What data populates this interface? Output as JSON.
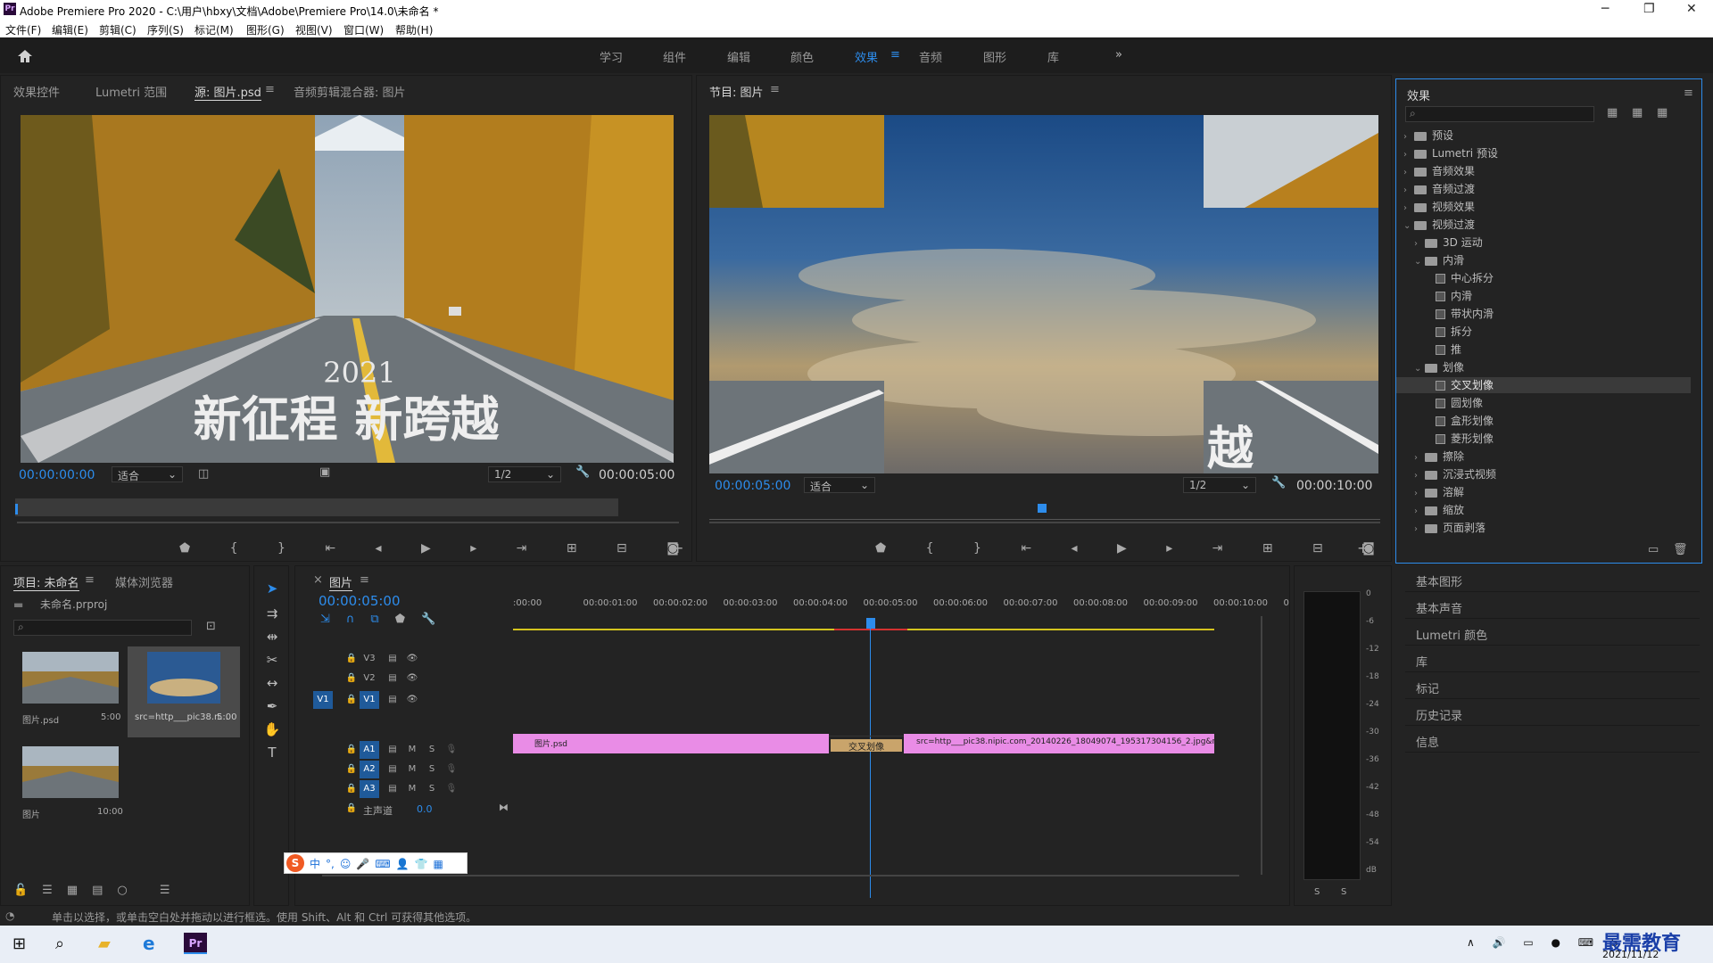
{
  "window": {
    "title": "Adobe Premiere Pro 2020 - C:\\用户\\hbxy\\文档\\Adobe\\Premiere Pro\\14.0\\未命名 *",
    "app_icon": "Pr"
  },
  "menu": [
    "文件(F)",
    "编辑(E)",
    "剪辑(C)",
    "序列(S)",
    "标记(M)",
    "图形(G)",
    "视图(V)",
    "窗口(W)",
    "帮助(H)"
  ],
  "workspaces": [
    "学习",
    "组件",
    "编辑",
    "颜色",
    "效果",
    "音频",
    "图形",
    "库"
  ],
  "workspace_active": "效果",
  "workspace_more": "»",
  "source": {
    "tabs": [
      "效果控件",
      "Lumetri 范围",
      "源: 图片.psd",
      "音频剪辑混合器: 图片"
    ],
    "active_tab": "源: 图片.psd",
    "overlay_year": "2021",
    "overlay_text": "新征程 新跨越",
    "timecode": "00:00:00:00",
    "fit": "适合",
    "res": "1/2",
    "duration": "00:00:05:00"
  },
  "program": {
    "title": "节目: 图片",
    "timecode": "00:00:05:00",
    "fit": "适合",
    "res": "1/2",
    "duration": "00:00:10:00",
    "overlay_char": "越"
  },
  "effects": {
    "title": "效果",
    "items": [
      {
        "label": "预设",
        "level": 0,
        "type": "folder",
        "open": false
      },
      {
        "label": "Lumetri 预设",
        "level": 0,
        "type": "folder",
        "open": false
      },
      {
        "label": "音频效果",
        "level": 0,
        "type": "folder",
        "open": false
      },
      {
        "label": "音频过渡",
        "level": 0,
        "type": "folder",
        "open": false
      },
      {
        "label": "视频效果",
        "level": 0,
        "type": "folder",
        "open": false
      },
      {
        "label": "视频过渡",
        "level": 0,
        "type": "folder",
        "open": true
      },
      {
        "label": "3D 运动",
        "level": 1,
        "type": "folder",
        "open": false
      },
      {
        "label": "内滑",
        "level": 1,
        "type": "folder",
        "open": true
      },
      {
        "label": "中心拆分",
        "level": 2,
        "type": "fx"
      },
      {
        "label": "内滑",
        "level": 2,
        "type": "fx"
      },
      {
        "label": "带状内滑",
        "level": 2,
        "type": "fx"
      },
      {
        "label": "拆分",
        "level": 2,
        "type": "fx"
      },
      {
        "label": "推",
        "level": 2,
        "type": "fx"
      },
      {
        "label": "划像",
        "level": 1,
        "type": "folder",
        "open": true
      },
      {
        "label": "交叉划像",
        "level": 2,
        "type": "fx",
        "selected": true
      },
      {
        "label": "圆划像",
        "level": 2,
        "type": "fx"
      },
      {
        "label": "盒形划像",
        "level": 2,
        "type": "fx"
      },
      {
        "label": "菱形划像",
        "level": 2,
        "type": "fx"
      },
      {
        "label": "擦除",
        "level": 1,
        "type": "folder",
        "open": false
      },
      {
        "label": "沉浸式视频",
        "level": 1,
        "type": "folder",
        "open": false
      },
      {
        "label": "溶解",
        "level": 1,
        "type": "folder",
        "open": false
      },
      {
        "label": "缩放",
        "level": 1,
        "type": "folder",
        "open": false
      },
      {
        "label": "页面剥落",
        "level": 1,
        "type": "folder",
        "open": false
      }
    ]
  },
  "right_panels": [
    "基本图形",
    "基本声音",
    "Lumetri 颜色",
    "库",
    "标记",
    "历史记录",
    "信息"
  ],
  "project": {
    "tabs": [
      "项目: 未命名",
      "媒体浏览器"
    ],
    "file": "未命名.prproj",
    "items": [
      {
        "name": "图片.psd",
        "dur": "5:00"
      },
      {
        "name": "src=http___pic38.n...",
        "dur": "5:00"
      },
      {
        "name": "图片",
        "dur": "10:00"
      }
    ]
  },
  "timeline": {
    "title": "图片",
    "timecode": "00:00:05:00",
    "ruler": [
      ":00:00",
      "00:00:01:00",
      "00:00:02:00",
      "00:00:03:00",
      "00:00:04:00",
      "00:00:05:00",
      "00:00:06:00",
      "00:00:07:00",
      "00:00:08:00",
      "00:00:09:00",
      "00:00:10:00",
      "0"
    ],
    "video_tracks": [
      "V3",
      "V2",
      "V1"
    ],
    "audio_tracks": [
      "A1",
      "A2",
      "A3"
    ],
    "source_patch": "V1",
    "master_label": "主声道",
    "master_value": "0.0",
    "clip1": "图片.psd",
    "transition": "交叉划像",
    "clip2": "src=http___pic38.nipic.com_20140226_18049074_195317304156_2.jpg&refer="
  },
  "meter": {
    "scale": [
      "0",
      "-6",
      "-12",
      "-18",
      "-24",
      "-30",
      "-36",
      "-42",
      "-48",
      "-54",
      "dB"
    ],
    "solo": [
      "S",
      "S"
    ]
  },
  "ime": {
    "icons": [
      "中",
      "°,",
      "☺",
      "🎤",
      "⌨",
      "👤",
      "👕",
      "▦"
    ]
  },
  "status_text": "单击以选择，或单击空白处并拖动以进行框选。使用 Shift、Alt 和 Ctrl 可获得其他选项。",
  "tray": {
    "date": "2021/11/12",
    "watermark": "最需教育"
  },
  "colors": {
    "accent": "#2d8ceb",
    "clip": "#e98ce6",
    "transition": "#c9a46b"
  }
}
